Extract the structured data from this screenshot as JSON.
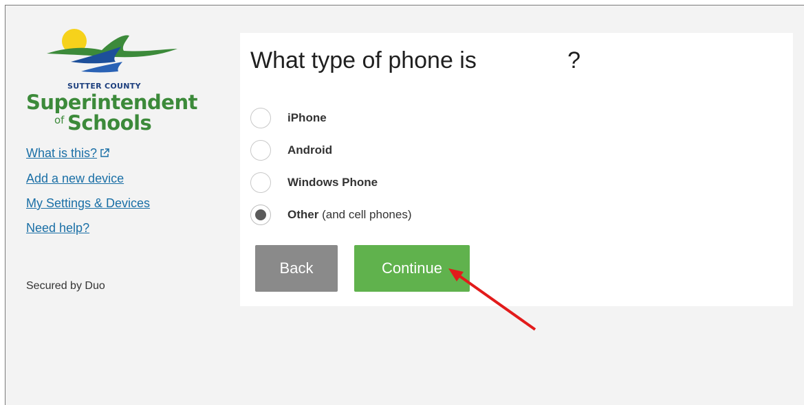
{
  "logo": {
    "county": "SUTTER COUNTY",
    "title_line1": "Superintendent",
    "title_of": "of",
    "title_line2": "Schools"
  },
  "sidebar": {
    "links": [
      {
        "label": "What is this?",
        "icon": "external-link-icon"
      },
      {
        "label": "Add a new device"
      },
      {
        "label": "My Settings & Devices"
      },
      {
        "label": "Need help?"
      }
    ],
    "secured": "Secured by Duo"
  },
  "question": {
    "text_start": "What type of phone is",
    "text_end": "?"
  },
  "options": [
    {
      "label": "iPhone",
      "extra": "",
      "checked": false
    },
    {
      "label": "Android",
      "extra": "",
      "checked": false
    },
    {
      "label": "Windows Phone",
      "extra": "",
      "checked": false
    },
    {
      "label": "Other",
      "extra": "(and cell phones)",
      "checked": true
    }
  ],
  "buttons": {
    "back": "Back",
    "continue": "Continue"
  },
  "colors": {
    "continue": "#60b24d",
    "back": "#8a8a8a",
    "link": "#1a6fa6",
    "annotation_arrow": "#e21b1b"
  }
}
